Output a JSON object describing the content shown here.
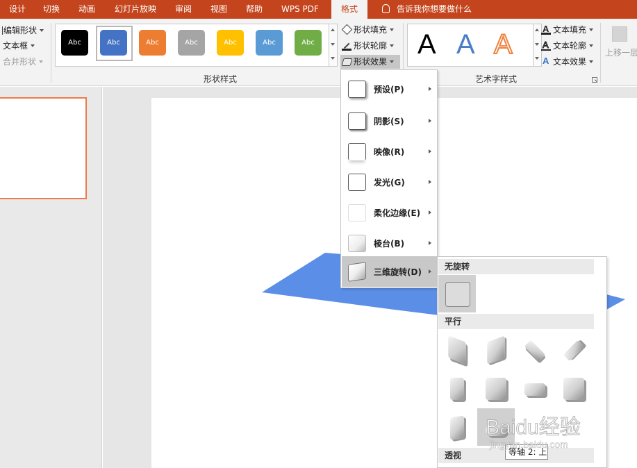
{
  "tabs": [
    {
      "label": "设计"
    },
    {
      "label": "切换"
    },
    {
      "label": "动画"
    },
    {
      "label": "幻灯片放映"
    },
    {
      "label": "审阅"
    },
    {
      "label": "视图"
    },
    {
      "label": "帮助"
    },
    {
      "label": "WPS PDF"
    },
    {
      "label": "格式"
    }
  ],
  "active_tab": "格式",
  "tell_me": "告诉我你想要做什么",
  "insert_group": {
    "edit_shape": "编辑形状",
    "text_box": "文本框",
    "merge_shapes": "合并形状"
  },
  "shape_styles": {
    "label": "形状样式",
    "swatch_text": "Abc",
    "swatch_colors": [
      "#000000",
      "#4472c4",
      "#ed7d31",
      "#a5a5a5",
      "#ffc000",
      "#5b9bd5",
      "#70ad47"
    ],
    "fill": "形状填充",
    "outline": "形状轮廓",
    "effects": "形状效果"
  },
  "wordart": {
    "label": "艺术字样式",
    "letter": "A",
    "text_fill": "文本填充",
    "text_outline": "文本轮廓",
    "text_effects": "文本效果"
  },
  "arrange": {
    "bring_forward": "上移一层"
  },
  "effects_menu": {
    "items": [
      {
        "label": "预设(P)"
      },
      {
        "label": "阴影(S)"
      },
      {
        "label": "映像(R)"
      },
      {
        "label": "发光(G)"
      },
      {
        "label": "柔化边缘(E)"
      },
      {
        "label": "棱台(B)"
      },
      {
        "label": "三维旋转(D)"
      }
    ],
    "hovered": "三维旋转(D)"
  },
  "rotation_menu": {
    "sections": [
      {
        "label": "无旋转"
      },
      {
        "label": "平行"
      },
      {
        "label": "透视"
      }
    ],
    "tooltip": "等轴 2: 上"
  },
  "colors": {
    "accent": "#c4451d",
    "shape_fill": "#5b8ee6",
    "selection_border": "#ee7a4a"
  },
  "watermark": {
    "brand": "Baidu经验",
    "url": "jingyan.baidu.com"
  }
}
